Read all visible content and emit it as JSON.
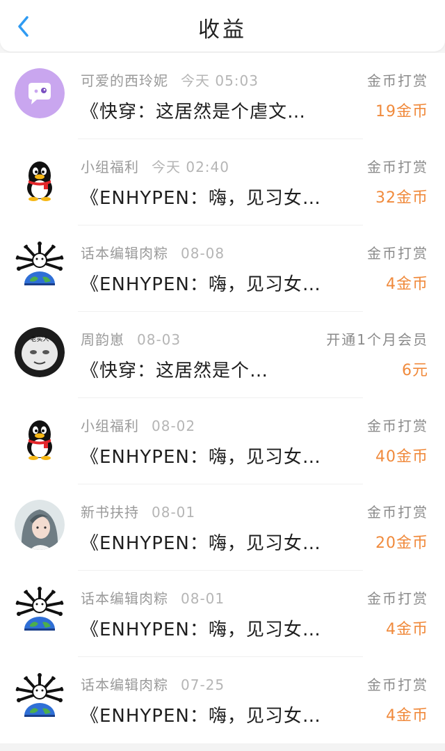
{
  "header": {
    "title": "收益",
    "back_icon": "chevron-left-icon",
    "accent": "#2f9bf2"
  },
  "colors": {
    "amount": "#f08a3c",
    "meta": "#9a9a9a"
  },
  "records": [
    {
      "avatar": "chat-bubble",
      "source": "可爱的西玲妮",
      "time": "今天 05:03",
      "type": "金币打赏",
      "book": "《快穿：这居然是个虐文…",
      "amount": "19金币"
    },
    {
      "avatar": "penguin",
      "source": "小组福利",
      "time": "今天 02:40",
      "type": "金币打赏",
      "book": "《ENHYPEN：嗨，见习女…",
      "amount": "32金币"
    },
    {
      "avatar": "globe-cartoon",
      "source": "话本编辑肉粽",
      "time": "08-08",
      "type": "金币打赏",
      "book": "《ENHYPEN：嗨，见习女…",
      "amount": "4金币"
    },
    {
      "avatar": "meme-face",
      "source": "周韵崽",
      "time": "08-03",
      "type": "开通1个月会员",
      "book": "《快穿：这居然是个…",
      "amount": "6元"
    },
    {
      "avatar": "penguin",
      "source": "小组福利",
      "time": "08-02",
      "type": "金币打赏",
      "book": "《ENHYPEN：嗨，见习女…",
      "amount": "40金币"
    },
    {
      "avatar": "anime-portrait",
      "source": "新书扶持",
      "time": "08-01",
      "type": "金币打赏",
      "book": "《ENHYPEN：嗨，见习女…",
      "amount": "20金币"
    },
    {
      "avatar": "globe-cartoon",
      "source": "话本编辑肉粽",
      "time": "08-01",
      "type": "金币打赏",
      "book": "《ENHYPEN：嗨，见习女…",
      "amount": "4金币"
    },
    {
      "avatar": "globe-cartoon",
      "source": "话本编辑肉粽",
      "time": "07-25",
      "type": "金币打赏",
      "book": "《ENHYPEN：嗨，见习女…",
      "amount": "4金币"
    }
  ],
  "meme_label": "老实人"
}
